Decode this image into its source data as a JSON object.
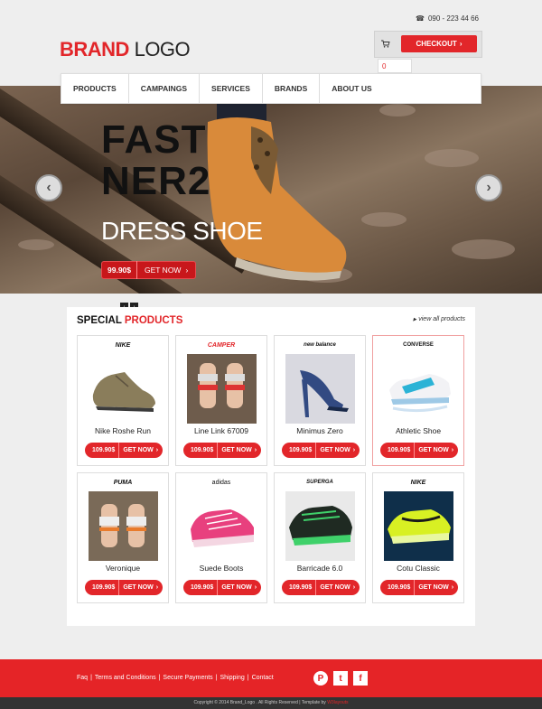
{
  "header": {
    "phone": "090 - 223 44 66",
    "phone_icon": "phone-icon",
    "logo_brand": "BRAND",
    "logo_word": "LOGO",
    "checkout_label": "CHECKOUT",
    "cart_count": "0"
  },
  "nav": {
    "items": [
      "PRODUCTS",
      "CAMPAINGS",
      "SERVICES",
      "BRANDS",
      "ABOUT US"
    ]
  },
  "hero": {
    "title_line1": "FAST",
    "title_line2": "NER2",
    "subtitle": "DRESS SHOE",
    "price": "99.90$",
    "cta": "GET NOW",
    "prev_icon": "chevron-left-icon",
    "next_icon": "chevron-right-icon"
  },
  "slider_dots": [
    "‹",
    "›"
  ],
  "products_section": {
    "title_plain": "SPECIAL",
    "title_red": "PRODUCTS",
    "view_all": "view all products",
    "products": [
      {
        "brand": "NIKE",
        "name": "Nike Roshe Run",
        "price": "109.90$",
        "cta": "GET NOW"
      },
      {
        "brand": "CAMPER",
        "name": "Line Link 67009",
        "price": "109.90$",
        "cta": "GET NOW"
      },
      {
        "brand": "new balance",
        "name": "Minimus Zero",
        "price": "109.90$",
        "cta": "GET NOW"
      },
      {
        "brand": "CONVERSE",
        "name": "Athletic Shoe",
        "price": "109.90$",
        "cta": "GET NOW"
      },
      {
        "brand": "PUMA",
        "name": "Veronique",
        "price": "109.90$",
        "cta": "GET NOW"
      },
      {
        "brand": "adidas",
        "name": "Suede Boots",
        "price": "109.90$",
        "cta": "GET NOW"
      },
      {
        "brand": "SUPERGA",
        "name": "Barricade 6.0",
        "price": "109.90$",
        "cta": "GET NOW"
      },
      {
        "brand": "NIKE",
        "name": "Cotu Classic",
        "price": "109.90$",
        "cta": "GET NOW"
      }
    ]
  },
  "footer": {
    "links": [
      "Faq",
      "Terms and Conditions",
      "Secure Payments",
      "Shipping",
      "Contact"
    ],
    "social": [
      "pinterest-icon",
      "twitter-icon",
      "facebook-icon"
    ],
    "copyright": "Copyright © 2014 Brand_Logo . All Rights Reserved | Template by",
    "author": "W3layouts"
  },
  "colors": {
    "accent": "#e2262a",
    "footer_bg": "#e52427",
    "copyright_bg": "#333333"
  }
}
